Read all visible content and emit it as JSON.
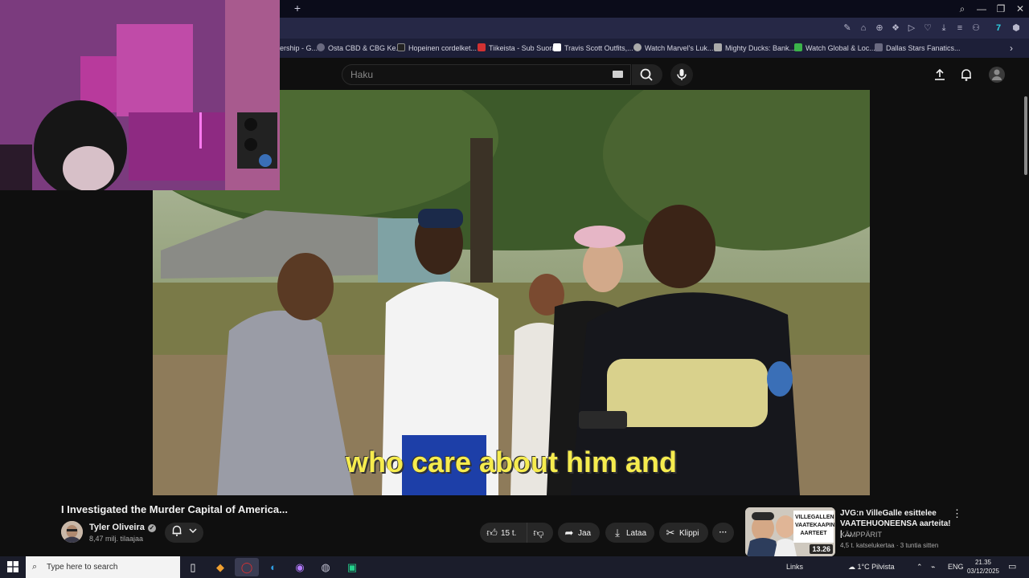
{
  "browser": {
    "new_tab": "+",
    "window_controls": [
      "⌕",
      "—",
      "❐",
      "✕"
    ],
    "extensions": [
      "✎",
      "⌂",
      "⊕",
      "❖",
      "▷",
      "♡",
      "⤓",
      "≡",
      "⚇",
      "7",
      "⬢"
    ],
    "bookmarks": [
      {
        "label": "ership - G...",
        "color": "#6a6a80"
      },
      {
        "label": "Osta CBD & CBG Ke...",
        "color": "#6a6a80"
      },
      {
        "label": "Hopeinen cordelket...",
        "color": "#222222"
      },
      {
        "label": "Tiikeista - Sub Suora",
        "color": "#d23232"
      },
      {
        "label": "Travis Scott Outfits,...",
        "color": "#ffffff"
      },
      {
        "label": "Watch Marvel's Luk...",
        "color": "#aaaaaa"
      },
      {
        "label": "Mighty Ducks: Bank...",
        "color": "#aaaaaa"
      },
      {
        "label": "Watch Global & Loc...",
        "color": "#3bb34a"
      },
      {
        "label": "Dallas Stars Fanatics...",
        "color": "#6a6a80"
      }
    ],
    "bookmarks_more": "›"
  },
  "youtube": {
    "search_placeholder": "Haku",
    "icons": {
      "search": "search-icon",
      "mic": "mic-icon",
      "upload": "upload-icon",
      "bell": "bell-icon"
    },
    "video": {
      "subtitle": "who care about him and"
    },
    "title": "I Investigated the Murder Capital of America...",
    "channel": {
      "name": "Tyler Oliveira",
      "subscribers": "8,47 milj. tilaajaa"
    },
    "actions": {
      "likes": "15 t.",
      "share": "Jaa",
      "download": "Lataa",
      "clip": "Klippi",
      "more": "···"
    },
    "recommendation": {
      "title": "JVG:n VilleGalle esittelee VAATEHUONEENSA aarteita! | ...",
      "channel": "KÄMPPÄRIT",
      "meta": "4,5 t. katselukertaa · 3 tuntia sitten",
      "duration": "13.26",
      "thumb_text": "VILLEGALLEN VAATEKAAPIN AARTEET"
    }
  },
  "taskbar": {
    "search_placeholder": "Type here to search",
    "links": "Links",
    "weather": "1°C  Pilvista",
    "language": "ENG",
    "time": "21.35",
    "date": "03/12/2025"
  },
  "colors": {
    "accent": "#f6ec4e",
    "youtube_bg": "#0f0f0f",
    "taskbar_bg": "#1b1d2b"
  }
}
